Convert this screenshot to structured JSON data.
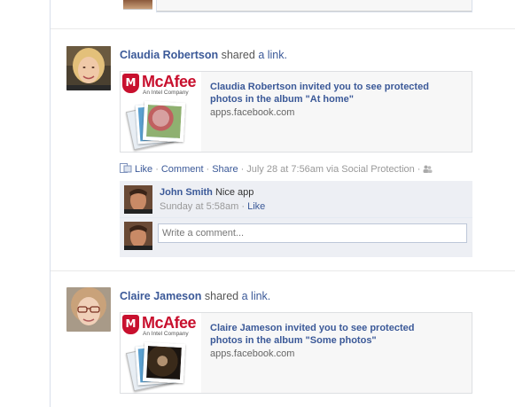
{
  "stories": [
    {
      "actor": "Claudia Robertson",
      "verb": "shared",
      "object_link": "a link.",
      "attachment": {
        "brand": "McAfee",
        "brand_tagline": "An Intel Company",
        "title": "Claudia Robertson invited you to see protected photos in the album \"At home\"",
        "domain": "apps.facebook.com"
      },
      "actions": {
        "like": "Like",
        "comment": "Comment",
        "share": "Share",
        "timestamp": "July 28 at 7:56am via Social Protection"
      },
      "comments": [
        {
          "author": "John Smith",
          "text": "Nice app",
          "time": "Sunday at 5:58am",
          "like": "Like"
        }
      ],
      "comment_placeholder": "Write a comment..."
    },
    {
      "actor": "Claire Jameson",
      "verb": "shared",
      "object_link": "a link.",
      "attachment": {
        "brand": "McAfee",
        "brand_tagline": "An Intel Company",
        "title": "Claire Jameson invited you to see protected photos in the album \"Some photos\"",
        "domain": "apps.facebook.com"
      }
    }
  ],
  "colors": {
    "link": "#3b5998",
    "mcafee_red": "#c8102e",
    "ufi_background": "#edeff4"
  }
}
